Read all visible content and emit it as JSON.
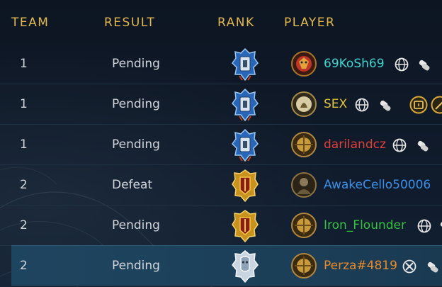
{
  "header": {
    "team": "TEAM",
    "result": "RESULT",
    "rank": "RANK",
    "player": "PLAYER"
  },
  "rows": [
    {
      "team": "1",
      "result": "Pending",
      "player": "69KoSh69",
      "player_color": "#3fd4cf",
      "rank_icon": "silver-blue-rank-icon",
      "platform": "globe-icon"
    },
    {
      "team": "1",
      "result": "Pending",
      "player": "SEX",
      "player_color": "#e2c33a",
      "rank_icon": "silver-blue-rank-icon",
      "platform": "globe-icon"
    },
    {
      "team": "1",
      "result": "Pending",
      "player": "darilandcz",
      "player_color": "#e0403a",
      "rank_icon": "silver-blue-rank-icon",
      "platform": "globe-icon"
    },
    {
      "team": "2",
      "result": "Defeat",
      "player": "AwakeCello50006",
      "player_color": "#3d8fe8",
      "rank_icon": "gold-rank-icon",
      "platform": "globe-icon"
    },
    {
      "team": "2",
      "result": "Pending",
      "player": "Iron_Flounder",
      "player_color": "#35c042",
      "rank_icon": "gold-rank-icon",
      "platform": "globe-icon"
    },
    {
      "team": "2",
      "result": "Pending",
      "player": "Perza#4819",
      "player_color": "#e88a2a",
      "rank_icon": "white-rank-icon",
      "platform": "xbox-icon"
    }
  ]
}
